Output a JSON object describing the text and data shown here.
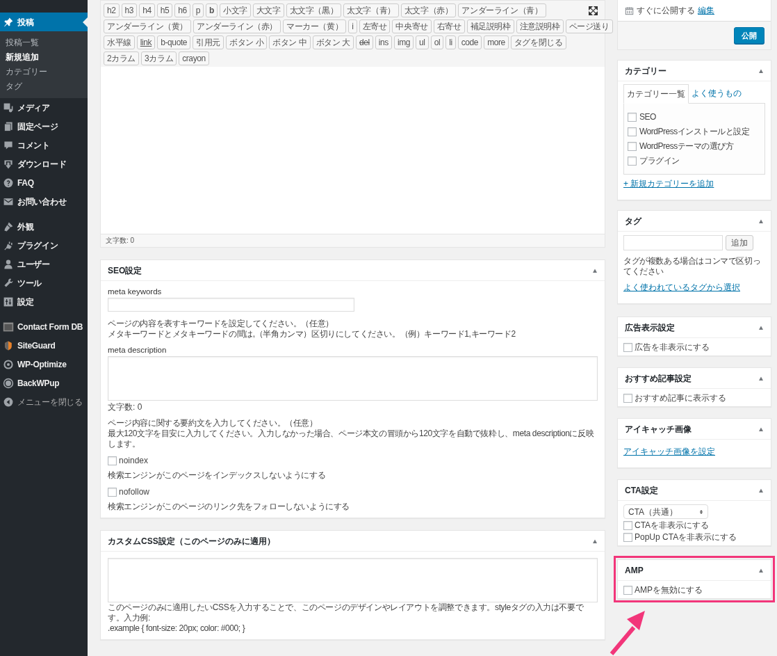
{
  "sidebar": {
    "groups": [
      {
        "items": [
          {
            "label": "投稿",
            "kind": "pin",
            "selected": true,
            "submenu": [
              {
                "label": "投稿一覧",
                "selected": false
              },
              {
                "label": "新規追加",
                "selected": true
              },
              {
                "label": "カテゴリー",
                "selected": false
              },
              {
                "label": "タグ",
                "selected": false
              }
            ]
          },
          {
            "label": "メディア",
            "kind": "media",
            "selected": false
          },
          {
            "label": "固定ページ",
            "kind": "pages",
            "selected": false
          },
          {
            "label": "コメント",
            "kind": "comment",
            "selected": false
          },
          {
            "label": "ダウンロード",
            "kind": "download",
            "selected": false
          },
          {
            "label": "FAQ",
            "kind": "help",
            "selected": false
          },
          {
            "label": "お問い合わせ",
            "kind": "mail",
            "selected": false
          }
        ]
      },
      {
        "items": [
          {
            "label": "外観",
            "kind": "brush",
            "selected": false
          },
          {
            "label": "プラグイン",
            "kind": "plugin",
            "selected": false
          },
          {
            "label": "ユーザー",
            "kind": "user",
            "selected": false
          },
          {
            "label": "ツール",
            "kind": "wrench",
            "selected": false
          },
          {
            "label": "設定",
            "kind": "settings",
            "selected": false
          }
        ]
      },
      {
        "items": [
          {
            "label": "Contact Form DB",
            "kind": "database",
            "selected": false
          },
          {
            "label": "SiteGuard",
            "kind": "shield",
            "selected": false
          },
          {
            "label": "WP-Optimize",
            "kind": "optimize",
            "selected": false
          },
          {
            "label": "BackWPup",
            "kind": "backup",
            "selected": false
          },
          {
            "label": "メニューを閉じる",
            "kind": "collapse",
            "selected": false
          }
        ]
      }
    ]
  },
  "editor": {
    "toolbar_rows": [
      [
        {
          "label": "h2",
          "kind": "plain"
        },
        {
          "label": "h3",
          "kind": "plain"
        },
        {
          "label": "h4",
          "kind": "plain"
        },
        {
          "label": "h5",
          "kind": "plain"
        },
        {
          "label": "h6",
          "kind": "plain"
        },
        {
          "label": "p",
          "kind": "plain"
        },
        {
          "label": "b",
          "kind": "bold"
        },
        {
          "label": "小文字",
          "kind": "plain"
        },
        {
          "label": "大文字",
          "kind": "plain"
        },
        {
          "label": "太文字（黒）",
          "kind": "plain"
        },
        {
          "label": "太文字（青）",
          "kind": "plain"
        },
        {
          "label": "太文字（赤）",
          "kind": "plain"
        },
        {
          "label": "アンダーライン（青）",
          "kind": "plain"
        }
      ],
      [
        {
          "label": "アンダーライン（黄）",
          "kind": "plain"
        },
        {
          "label": "アンダーライン（赤）",
          "kind": "plain"
        },
        {
          "label": "マーカー（黄）",
          "kind": "plain"
        },
        {
          "label": "i",
          "kind": "plain"
        },
        {
          "label": "左寄せ",
          "kind": "plain"
        },
        {
          "label": "中央寄せ",
          "kind": "plain"
        },
        {
          "label": "右寄せ",
          "kind": "plain"
        },
        {
          "label": "補足説明枠",
          "kind": "plain"
        },
        {
          "label": "注意説明枠",
          "kind": "plain"
        },
        {
          "label": "ページ送り",
          "kind": "plain"
        }
      ],
      [
        {
          "label": "水平線",
          "kind": "plain"
        },
        {
          "label": "link",
          "kind": "link"
        },
        {
          "label": "b-quote",
          "kind": "plain"
        },
        {
          "label": "引用元",
          "kind": "plain"
        },
        {
          "label": "ボタン 小",
          "kind": "plain"
        },
        {
          "label": "ボタン 中",
          "kind": "plain"
        },
        {
          "label": "ボタン 大",
          "kind": "plain"
        },
        {
          "label": "del",
          "kind": "strike"
        },
        {
          "label": "ins",
          "kind": "plain"
        },
        {
          "label": "img",
          "kind": "plain"
        },
        {
          "label": "ul",
          "kind": "plain"
        },
        {
          "label": "ol",
          "kind": "plain"
        },
        {
          "label": "li",
          "kind": "plain"
        },
        {
          "label": "code",
          "kind": "plain"
        },
        {
          "label": "more",
          "kind": "plain"
        },
        {
          "label": "タグを閉じる",
          "kind": "plain"
        }
      ],
      [
        {
          "label": "2カラム",
          "kind": "plain"
        },
        {
          "label": "3カラム",
          "kind": "plain"
        },
        {
          "label": "crayon",
          "kind": "plain"
        }
      ]
    ],
    "word_count": "文字数: 0"
  },
  "main_boxes": [
    {
      "title": "SEO設定",
      "body": [
        {
          "kind": "label",
          "text": "meta keywords"
        },
        {
          "kind": "input"
        },
        {
          "kind": "text",
          "lines": [
            "ページの内容を表すキーワードを設定してください。（任意）",
            "メタキーワードとメタキーワードの間は,（半角カンマ）区切りにしてください。（例）キーワード1,キーワード2"
          ]
        },
        {
          "kind": "label",
          "text": "meta description"
        },
        {
          "kind": "textarea"
        },
        {
          "kind": "count",
          "text": "文字数: 0"
        },
        {
          "kind": "text",
          "lines": [
            "ページ内容に関する要約文を入力してください。（任意）",
            "最大120文字を目安に入力してください。入力しなかった場合、ページ本文の冒頭から120文字を自動で抜粋し、meta descriptionに反映します。"
          ]
        },
        {
          "kind": "checkbox",
          "text": "noindex",
          "checked": false
        },
        {
          "kind": "text",
          "lines": [
            "検索エンジンがこのページをインデックスしないようにする"
          ]
        },
        {
          "kind": "checkbox",
          "text": "nofollow",
          "checked": false
        },
        {
          "kind": "text",
          "lines": [
            "検索エンジンがこのページのリンク先をフォローしないようにする"
          ]
        }
      ]
    },
    {
      "title": "カスタムCSS設定（このページのみに適用）",
      "body": [
        {
          "kind": "textarea"
        },
        {
          "kind": "text",
          "lines": [
            "このページのみに適用したいCSSを入力することで、このページのデザインやレイアウトを調整できます。styleタグの入力は不要です。入力例:",
            ".example { font-size: 20px; color: #000; }"
          ]
        }
      ]
    }
  ],
  "publish": {
    "schedule": "すぐに公開する",
    "edit_link": "編集",
    "button": "公開"
  },
  "side_boxes": [
    {
      "title": "カテゴリー",
      "highlighted": false,
      "body": [
        {
          "kind": "tabs",
          "tabs": [
            {
              "label": "カテゴリー一覧",
              "selected": true
            },
            {
              "label": "よく使うもの",
              "selected": false
            }
          ],
          "items": [
            {
              "text": "SEO",
              "checked": false
            },
            {
              "text": "WordPressインストールと設定",
              "checked": false
            },
            {
              "text": "WordPressテーマの選び方",
              "checked": false
            },
            {
              "text": "プラグイン",
              "checked": false
            }
          ]
        },
        {
          "kind": "link",
          "text": "+ 新規カテゴリーを追加"
        }
      ]
    },
    {
      "title": "タグ",
      "highlighted": false,
      "body": [
        {
          "kind": "tag_input",
          "button": "追加"
        },
        {
          "kind": "text",
          "lines": [
            "タグが複数ある場合はコンマで区切ってください"
          ]
        },
        {
          "kind": "link",
          "text": "よく使われているタグから選択"
        }
      ]
    },
    {
      "title": "広告表示設定",
      "highlighted": false,
      "body": [
        {
          "kind": "checkbox",
          "text": "広告を非表示にする",
          "checked": false
        }
      ]
    },
    {
      "title": "おすすめ記事設定",
      "highlighted": false,
      "body": [
        {
          "kind": "checkbox",
          "text": "おすすめ記事に表示する",
          "checked": false
        }
      ]
    },
    {
      "title": "アイキャッチ画像",
      "highlighted": false,
      "body": [
        {
          "kind": "link",
          "text": "アイキャッチ画像を設定"
        }
      ]
    },
    {
      "title": "CTA設定",
      "highlighted": false,
      "body": [
        {
          "kind": "select",
          "value": "CTA（共通）"
        },
        {
          "kind": "checkbox",
          "text": "CTAを非表示にする",
          "checked": false
        },
        {
          "kind": "checkbox",
          "text": "PopUp CTAを非表示にする",
          "checked": false
        }
      ]
    },
    {
      "title": "AMP",
      "highlighted": true,
      "body": [
        {
          "kind": "checkbox",
          "text": "AMPを無効にする",
          "checked": false
        }
      ]
    }
  ]
}
